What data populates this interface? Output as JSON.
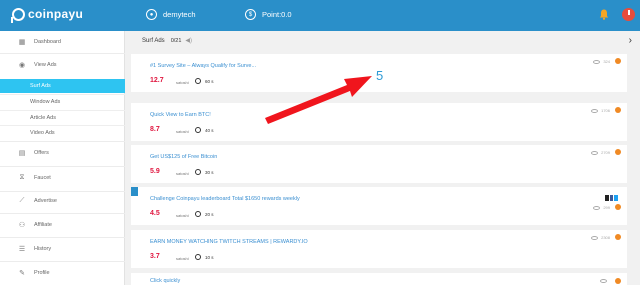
{
  "brand": {
    "name": "coinpayu"
  },
  "header": {
    "username": "demytech",
    "points": "Point:0.0"
  },
  "sidebar": {
    "items": [
      {
        "label": "Dashboard",
        "icon": "grid-icon"
      },
      {
        "label": "View Ads",
        "icon": "eye-icon"
      },
      {
        "label": "Offers",
        "icon": "offers-icon"
      },
      {
        "label": "Faucet",
        "icon": "faucet-icon"
      },
      {
        "label": "Advertise",
        "icon": "chart-icon"
      },
      {
        "label": "Affiliate",
        "icon": "users-icon"
      },
      {
        "label": "History",
        "icon": "list-icon"
      },
      {
        "label": "Profile",
        "icon": "edit-icon"
      }
    ],
    "subitems": [
      {
        "label": "Surf Ads",
        "active": true
      },
      {
        "label": "Window Ads"
      },
      {
        "label": "Article Ads"
      },
      {
        "label": "Video Ads"
      }
    ]
  },
  "main": {
    "title": "Surf Ads",
    "count": "0/21",
    "overlay_number": "5",
    "ads": [
      {
        "title": "#1 Survey Site – Always Qualify for Surve...",
        "amount": "12.7",
        "unit": "satoshi",
        "duration": "60 s",
        "views": "324"
      },
      {
        "title": "Quick View to Earn BTC!",
        "amount": "8.7",
        "unit": "satoshi",
        "duration": "40 s",
        "views": "1706"
      },
      {
        "title": "Get US$125 of Free Bitcoin",
        "amount": "5.9",
        "unit": "satoshi",
        "duration": "30 s",
        "views": "2709"
      },
      {
        "title": "Challenge Coinpayu leaderboard Total $1650 rewards weekly",
        "amount": "4.5",
        "unit": "satoshi",
        "duration": "20 s",
        "views": "299"
      },
      {
        "title": "EARN MONEY WATCHING TWITCH STREAMS | REWARDY.IO",
        "amount": "3.7",
        "unit": "satoshi",
        "duration": "10 s",
        "views": "2308"
      },
      {
        "title": "Click quickly",
        "amount": "",
        "unit": "",
        "duration": "",
        "views": ""
      }
    ]
  },
  "colors": {
    "header": "#2a8fc9",
    "active": "#2ec4f1",
    "amount": "#e0163f",
    "link": "#3a8fd1",
    "arrow": "#f0151d"
  }
}
